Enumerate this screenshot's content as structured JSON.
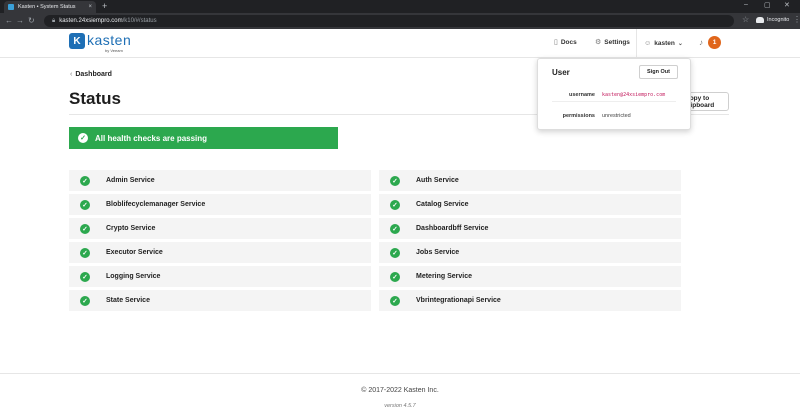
{
  "browser": {
    "tab_title": "Kasten • System Status",
    "tab_close": "×",
    "new_tab": "+",
    "url_host": "kasten.24xsiempro.com",
    "url_path": "/k10/#/status",
    "incognito_label": "Incognito",
    "window_controls": [
      "–",
      "▢",
      "✕"
    ]
  },
  "header": {
    "brand": "kasten",
    "brand_sub": "by Veeam",
    "docs_label": "Docs",
    "settings_label": "Settings",
    "user_label": "kasten",
    "notification_count": "1"
  },
  "page": {
    "breadcrumb": "Dashboard",
    "title": "Status",
    "clipboard_button": "Copy to clipboard",
    "banner": "All health checks are passing"
  },
  "services_left": [
    "Admin Service",
    "Bloblifecyclemanager Service",
    "Crypto Service",
    "Executor Service",
    "Logging Service",
    "State Service"
  ],
  "services_right": [
    "Auth Service",
    "Catalog Service",
    "Dashboardbff Service",
    "Jobs Service",
    "Metering Service",
    "Vbrintegrationapi Service"
  ],
  "user_menu": {
    "heading": "User",
    "sign_out": "Sign Out",
    "username_label": "username",
    "username_value": "kasten@24xsiempro.com",
    "permissions_label": "permissions",
    "permissions_value": "unrestricted"
  },
  "footer": {
    "copyright": "© 2017-2022 Kasten Inc.",
    "version": "version 4.5.7"
  },
  "colors": {
    "success": "#2ca84e",
    "brand": "#1e6fb5",
    "badge": "#e0661c"
  }
}
